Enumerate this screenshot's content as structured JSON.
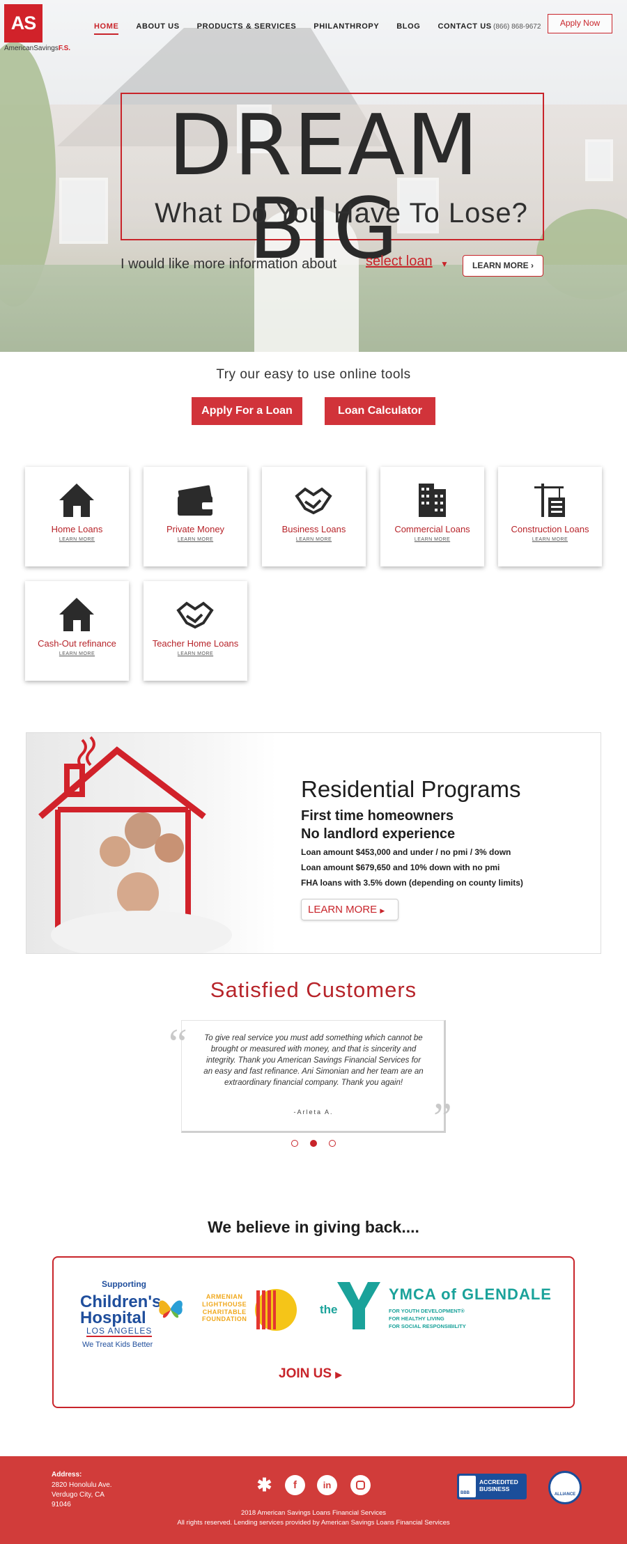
{
  "brand": {
    "logo_mark": "AS",
    "logo_name": "AmericanSavings",
    "logo_suffix": "F.S.",
    "accent_color": "#c8242a"
  },
  "nav": {
    "items": [
      "HOME",
      "ABOUT US",
      "PRODUCTS & SERVICES",
      "PHILANTHROPY",
      "BLOG",
      "CONTACT US"
    ],
    "active": "HOME",
    "phone": "(866) 868-9672",
    "apply_label": "Apply Now"
  },
  "hero": {
    "headline": "DREAM BIG",
    "subheadline": "What Do You Have To Lose?",
    "info_prefix": "I would like more information about",
    "select_value": "select loan",
    "learn_more": "LEARN MORE"
  },
  "tools": {
    "title": "Try our easy to use online tools",
    "apply_loan": "Apply For a Loan",
    "calculator": "Loan Calculator"
  },
  "loan_cards": [
    {
      "title": "Home Loans",
      "link": "LEARN MORE",
      "icon": "house-icon"
    },
    {
      "title": "Private Money",
      "link": "LEARN MORE",
      "icon": "money-icon"
    },
    {
      "title": "Business Loans",
      "link": "LEARN MORE",
      "icon": "handshake-icon"
    },
    {
      "title": "Commercial Loans",
      "link": "LEARN MORE",
      "icon": "building-icon"
    },
    {
      "title": "Construction Loans",
      "link": "LEARN MORE",
      "icon": "crane-icon"
    },
    {
      "title": "Cash-Out refinance",
      "link": "LEARN MORE",
      "icon": "house-icon"
    },
    {
      "title": "Teacher Home Loans",
      "link": "LEARN MORE",
      "icon": "handshake-icon"
    }
  ],
  "residential": {
    "title": "Residential Programs",
    "heading1": "First time homeowners",
    "heading2": "No landlord experience",
    "lines": [
      "Loan amount $453,000 and under / no pmi / 3% down",
      "Loan amount $679,650 and 10% down with no pmi",
      "FHA loans with 3.5% down (depending on county limits)"
    ],
    "button": "LEARN MORE"
  },
  "testimonials": {
    "title": "Satisfied Customers",
    "quote": "To give real service you must add something which cannot be brought or measured with money, and that is sincerity and integrity. Thank you American Savings Financial Services for an easy and fast refinance. Ani Simonian and her team are an extraordinary financial company. Thank you again!",
    "author": "-Arleta A.",
    "active_slide": 2,
    "slide_count": 3
  },
  "giving": {
    "title": "We believe in giving back....",
    "chla_supporting": "Supporting",
    "chla_name_1": "Children's",
    "chla_name_2": "Hospital",
    "chla_la": "LOS ANGELES",
    "chla_tagline": "We Treat Kids Better",
    "alcf_lines": [
      "ARMENIAN",
      "LIGHTHOUSE",
      "CHARITABLE",
      "FOUNDATION"
    ],
    "ymca_the": "the",
    "ymca_name": "YMCA of GLENDALE",
    "ymca_lines": [
      "FOR YOUTH DEVELOPMENT®",
      "FOR HEALTHY LIVING",
      "FOR SOCIAL RESPONSIBILITY"
    ],
    "join": "JOIN US"
  },
  "footer": {
    "address_label": "Address:",
    "address_lines": [
      "2820 Honolulu Ave.",
      "Verdugo City, CA",
      "91046"
    ],
    "copyright_1": "2018 American Savings Loans Financial Services",
    "copyright_2": "All rights reserved. Lending services provided by American Savings Loans Financial Services",
    "bbb_text_1": "ACCREDITED",
    "bbb_text_2": "BUSINESS",
    "bbb_label": "BBB",
    "alliance_label": "ALLIANCE",
    "social": [
      "yelp-icon",
      "facebook-icon",
      "linkedin-icon",
      "instagram-icon"
    ],
    "background": "#d13c3a"
  }
}
